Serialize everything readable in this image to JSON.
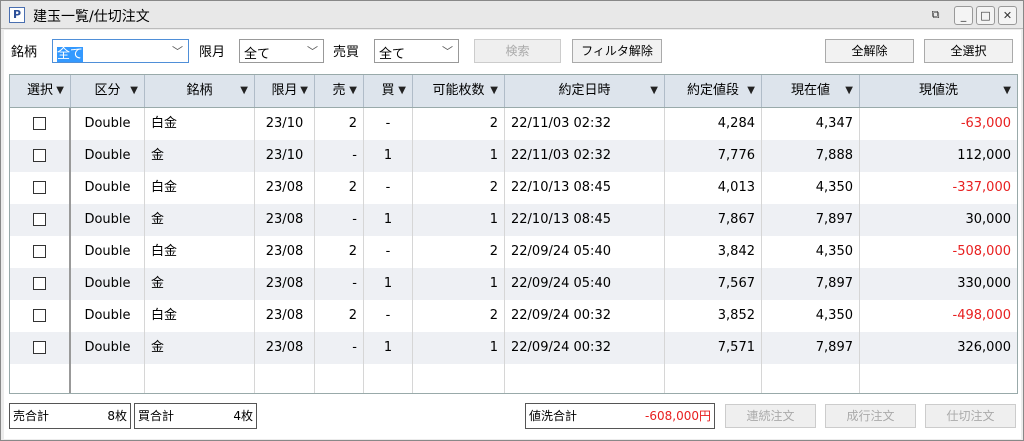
{
  "window": {
    "title": "建玉一覧/仕切注文",
    "icon": "P"
  },
  "filters": {
    "brand_label": "銘柄",
    "brand_value": "全て",
    "month_label": "限月",
    "month_value": "全て",
    "side_label": "売買",
    "side_value": "全て"
  },
  "toolbar": {
    "search": "検索",
    "clear_filter": "フィルタ解除",
    "deselect_all": "全解除",
    "select_all": "全選択"
  },
  "columns": [
    "選択",
    "区分",
    "銘柄",
    "限月",
    "売",
    "買",
    "可能枚数",
    "約定日時",
    "約定値段",
    "現在値",
    "現値洗"
  ],
  "rows": [
    {
      "type": "Double",
      "brand": "白金",
      "month": "23/10",
      "sell": "2",
      "buy": "-",
      "qty": "2",
      "date": "22/11/03 02:32",
      "price": "4,284",
      "current": "4,347",
      "pl": "-63,000",
      "neg": true
    },
    {
      "type": "Double",
      "brand": "金",
      "month": "23/10",
      "sell": "-",
      "buy": "1",
      "qty": "1",
      "date": "22/11/03 02:32",
      "price": "7,776",
      "current": "7,888",
      "pl": "112,000",
      "neg": false
    },
    {
      "type": "Double",
      "brand": "白金",
      "month": "23/08",
      "sell": "2",
      "buy": "-",
      "qty": "2",
      "date": "22/10/13 08:45",
      "price": "4,013",
      "current": "4,350",
      "pl": "-337,000",
      "neg": true
    },
    {
      "type": "Double",
      "brand": "金",
      "month": "23/08",
      "sell": "-",
      "buy": "1",
      "qty": "1",
      "date": "22/10/13 08:45",
      "price": "7,867",
      "current": "7,897",
      "pl": "30,000",
      "neg": false
    },
    {
      "type": "Double",
      "brand": "白金",
      "month": "23/08",
      "sell": "2",
      "buy": "-",
      "qty": "2",
      "date": "22/09/24 05:40",
      "price": "3,842",
      "current": "4,350",
      "pl": "-508,000",
      "neg": true
    },
    {
      "type": "Double",
      "brand": "金",
      "month": "23/08",
      "sell": "-",
      "buy": "1",
      "qty": "1",
      "date": "22/09/24 05:40",
      "price": "7,567",
      "current": "7,897",
      "pl": "330,000",
      "neg": false
    },
    {
      "type": "Double",
      "brand": "白金",
      "month": "23/08",
      "sell": "2",
      "buy": "-",
      "qty": "2",
      "date": "22/09/24 00:32",
      "price": "3,852",
      "current": "4,350",
      "pl": "-498,000",
      "neg": true
    },
    {
      "type": "Double",
      "brand": "金",
      "month": "23/08",
      "sell": "-",
      "buy": "1",
      "qty": "1",
      "date": "22/09/24 00:32",
      "price": "7,571",
      "current": "7,897",
      "pl": "326,000",
      "neg": false
    }
  ],
  "footer": {
    "sell_total_label": "売合計",
    "sell_total": "8枚",
    "buy_total_label": "買合計",
    "buy_total": "4枚",
    "pl_total_label": "値洗合計",
    "pl_total": "-608,000円",
    "btn_linked": "連続注文",
    "btn_market": "成行注文",
    "btn_close": "仕切注文"
  },
  "colors": {
    "negative": "#e82020",
    "header": "#dde4ec",
    "row_alt": "#eef0f4"
  }
}
